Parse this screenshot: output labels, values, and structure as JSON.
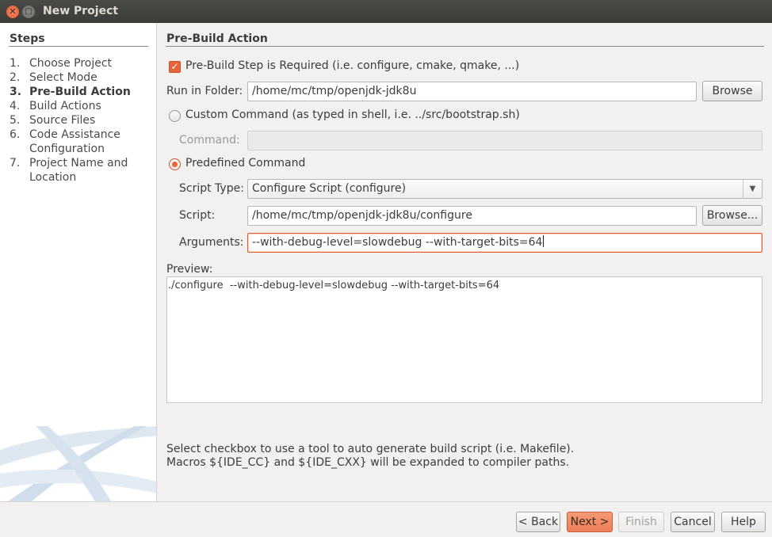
{
  "window": {
    "title": "New Project",
    "close_glyph": "✕",
    "maximize_glyph": "□"
  },
  "steps": {
    "title": "Steps",
    "items": [
      {
        "num": "1.",
        "label": "Choose Project"
      },
      {
        "num": "2.",
        "label": "Select Mode"
      },
      {
        "num": "3.",
        "label": "Pre-Build Action"
      },
      {
        "num": "4.",
        "label": "Build Actions"
      },
      {
        "num": "5.",
        "label": "Source Files"
      },
      {
        "num": "6.",
        "label": "Code Assistance Configuration"
      },
      {
        "num": "7.",
        "label": "Project Name and Location"
      }
    ],
    "current_index": 2
  },
  "main": {
    "title": "Pre-Build Action",
    "prebuild_checkbox": {
      "label": "Pre-Build Step is Required (i.e. configure, cmake, qmake, ...)",
      "checked": true
    },
    "run_in_folder": {
      "label": "Run in Folder:",
      "value": "/home/mc/tmp/openjdk-jdk8u",
      "browse_label": "Browse"
    },
    "custom_command": {
      "label": "Custom Command (as typed in shell, i.e. ../src/bootstrap.sh)",
      "selected": false
    },
    "command": {
      "label": "Command:",
      "value": ""
    },
    "predefined_command": {
      "label": "Predefined Command",
      "selected": true
    },
    "script_type": {
      "label": "Script Type:",
      "value": "Configure Script (configure)"
    },
    "script": {
      "label": "Script:",
      "value": "/home/mc/tmp/openjdk-jdk8u/configure",
      "browse_label": "Browse..."
    },
    "arguments": {
      "label": "Arguments:",
      "value": "--with-debug-level=slowdebug --with-target-bits=64"
    },
    "preview": {
      "label": "Preview:",
      "value": "./configure  --with-debug-level=slowdebug --with-target-bits=64"
    },
    "help_line1": "Select checkbox to use a tool to auto generate build script (i.e. Makefile).",
    "help_line2": "Macros ${IDE_CC} and ${IDE_CXX} will be expanded to compiler paths."
  },
  "footer": {
    "back_label": "< Back",
    "next_label": "Next >",
    "finish_label": "Finish",
    "cancel_label": "Cancel",
    "help_label": "Help"
  },
  "colors": {
    "accent": "#e8643c",
    "titlebar": "#3c3b37"
  }
}
